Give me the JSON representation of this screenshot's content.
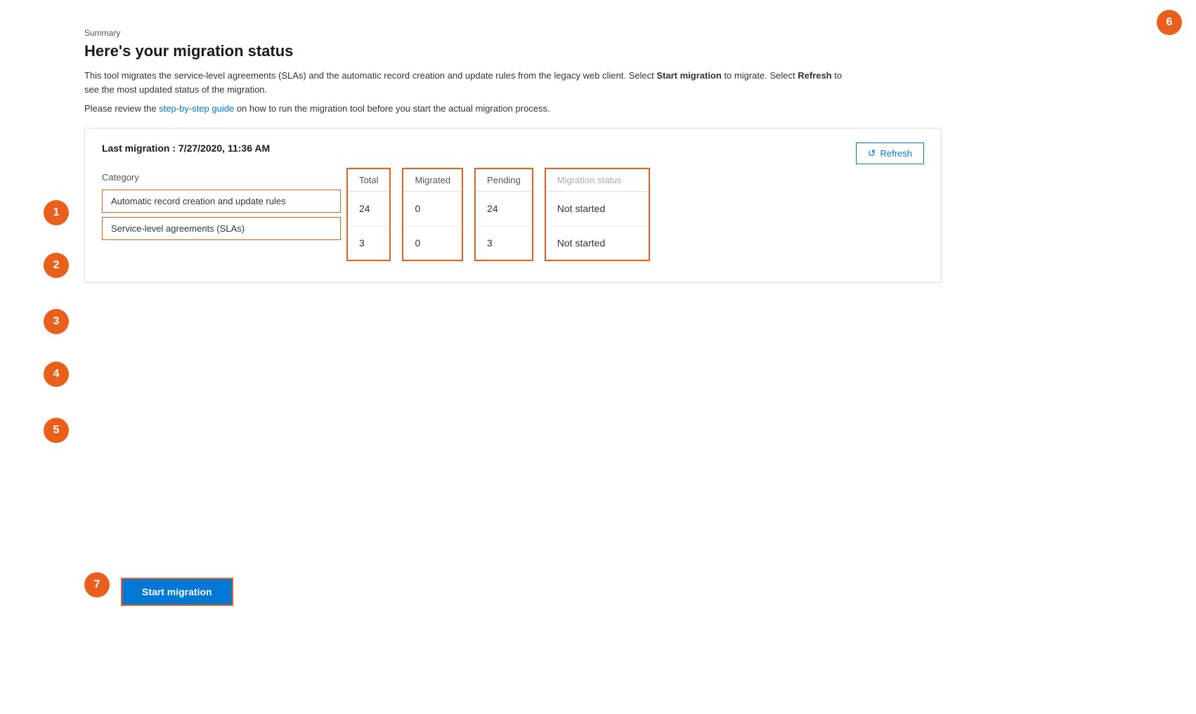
{
  "page": {
    "breadcrumb": "Summary",
    "title": "Here's your migration status",
    "description": "This tool migrates the service-level agreements (SLAs) and the automatic record creation and update rules from the legacy web client. Select ",
    "desc_bold1": "Start migration",
    "desc_mid": " to migrate. Select ",
    "desc_bold2": "Refresh",
    "desc_end": " to see the most updated status of the migration.",
    "guide_prefix": "Please review the ",
    "guide_link_text": "step-by-step guide",
    "guide_suffix": " on how to run the migration tool before you start the actual migration process."
  },
  "panel": {
    "last_migration_label": "Last migration : 7/27/2020, 11:36 AM",
    "refresh_button": "Refresh"
  },
  "table": {
    "col_category": "Category",
    "col_total": "Total",
    "col_migrated": "Migrated",
    "col_pending": "Pending",
    "col_status": "Migration status",
    "rows": [
      {
        "category": "Automatic record creation and update rules",
        "total": "24",
        "migrated": "0",
        "pending": "24",
        "status": "Not started"
      },
      {
        "category": "Service-level agreements (SLAs)",
        "total": "3",
        "migrated": "0",
        "pending": "3",
        "status": "Not started"
      }
    ]
  },
  "footer": {
    "start_migration_label": "Start migration"
  },
  "annotations": {
    "numbers": [
      "1",
      "2",
      "3",
      "4",
      "5",
      "6",
      "7"
    ]
  }
}
